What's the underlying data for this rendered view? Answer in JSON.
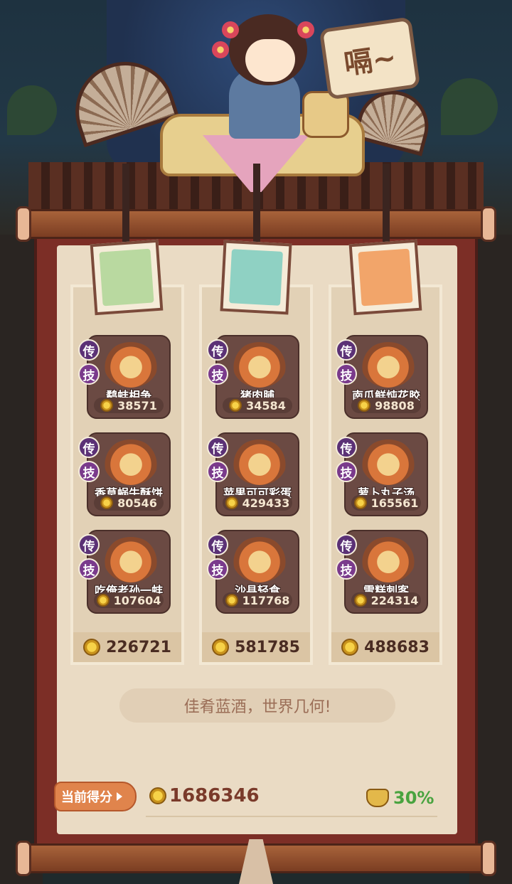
{
  "speech_bubble": "嗝~",
  "columns": [
    {
      "avatar_color": "#b9d9a0",
      "total": "226721",
      "dishes": [
        {
          "name": "鹬蚌相争",
          "value": "38571",
          "badges": [
            "传",
            "技"
          ]
        },
        {
          "name": "香草蜗牛酥饼",
          "value": "80546",
          "badges": [
            "传",
            "技"
          ]
        },
        {
          "name": "吃俺老孙一蚌",
          "value": "107604",
          "badges": [
            "传",
            "技"
          ]
        }
      ]
    },
    {
      "avatar_color": "#8fd1c3",
      "total": "581785",
      "dishes": [
        {
          "name": "猪肉脯",
          "value": "34584",
          "badges": [
            "传",
            "技"
          ]
        },
        {
          "name": "苹果可可彩蛋",
          "value": "429433",
          "badges": [
            "传",
            "技"
          ]
        },
        {
          "name": "沙县轻食",
          "value": "117768",
          "badges": [
            "传",
            "技"
          ]
        }
      ]
    },
    {
      "avatar_color": "#f2a56a",
      "total": "488683",
      "dishes": [
        {
          "name": "南瓜鲜炖花胶",
          "value": "98808",
          "badges": [
            "传",
            "技"
          ]
        },
        {
          "name": "萝卜丸子汤",
          "value": "165561",
          "badges": [
            "传",
            "技"
          ]
        },
        {
          "name": "雪糕刺客",
          "value": "224314",
          "badges": [
            "传",
            "技"
          ]
        }
      ]
    }
  ],
  "motto": "佳肴蓝酒，世界几何!",
  "score": {
    "label": "当前得分",
    "value": "1686346",
    "bonus": "30%"
  },
  "colors": {
    "scroll_frame": "#7c2e26",
    "paper": "#eadbc4",
    "badge_purple": "#5b3176",
    "score_tag": "#e0844c",
    "bonus_green": "#49a33f"
  }
}
